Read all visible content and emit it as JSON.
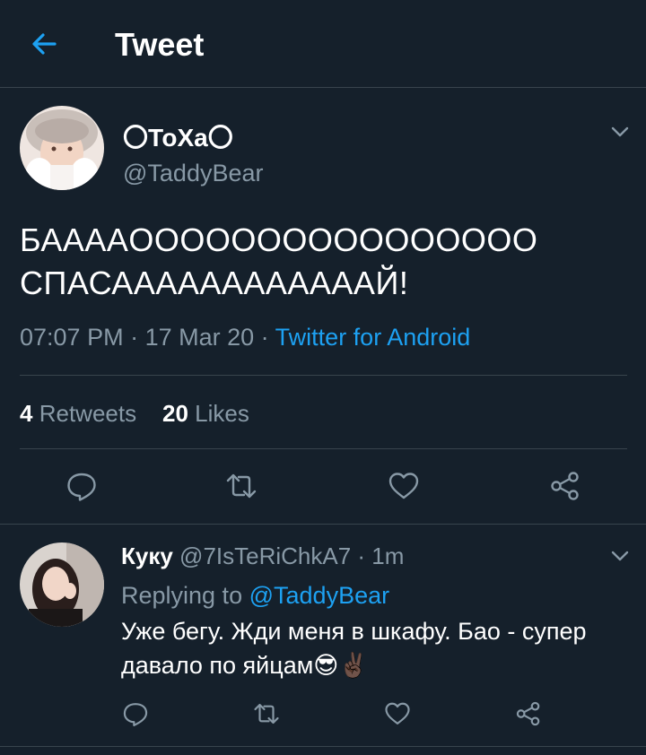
{
  "header": {
    "title": "Tweet"
  },
  "tweet": {
    "author_name": "〇ТоХа〇",
    "author_handle": "@TaddyBear",
    "text_line1": "БАААAOOOOOOOOOOOOOOOO",
    "text_line2": "СПАСААААААААААААЙ!",
    "time": "07:07 PM",
    "sep1": " · ",
    "date": "17 Mar 20",
    "sep2": " · ",
    "source": "Twitter for Android",
    "retweets_count": "4",
    "retweets_label": "Retweets",
    "likes_count": "20",
    "likes_label": "Likes"
  },
  "reply": {
    "author_name": "Куку",
    "author_handle": "@7IsTeRiChkA7",
    "sep": " · ",
    "age": "1m",
    "replying_to_label": "Replying to",
    "replying_to_handle": "@TaddyBear",
    "text": "Уже бегу. Жди меня в шкафу. Бао - супер давало по яйцам😎✌🏿"
  },
  "icons": {
    "back": "arrow-left-icon",
    "caret": "chevron-down-icon",
    "reply": "comment-icon",
    "retweet": "retweet-icon",
    "like": "heart-icon",
    "share": "share-icon"
  },
  "colors": {
    "background": "#15202b",
    "border": "#38444d",
    "secondary_text": "#8899a6",
    "accent": "#1da1f2",
    "primary_text": "#ffffff"
  }
}
